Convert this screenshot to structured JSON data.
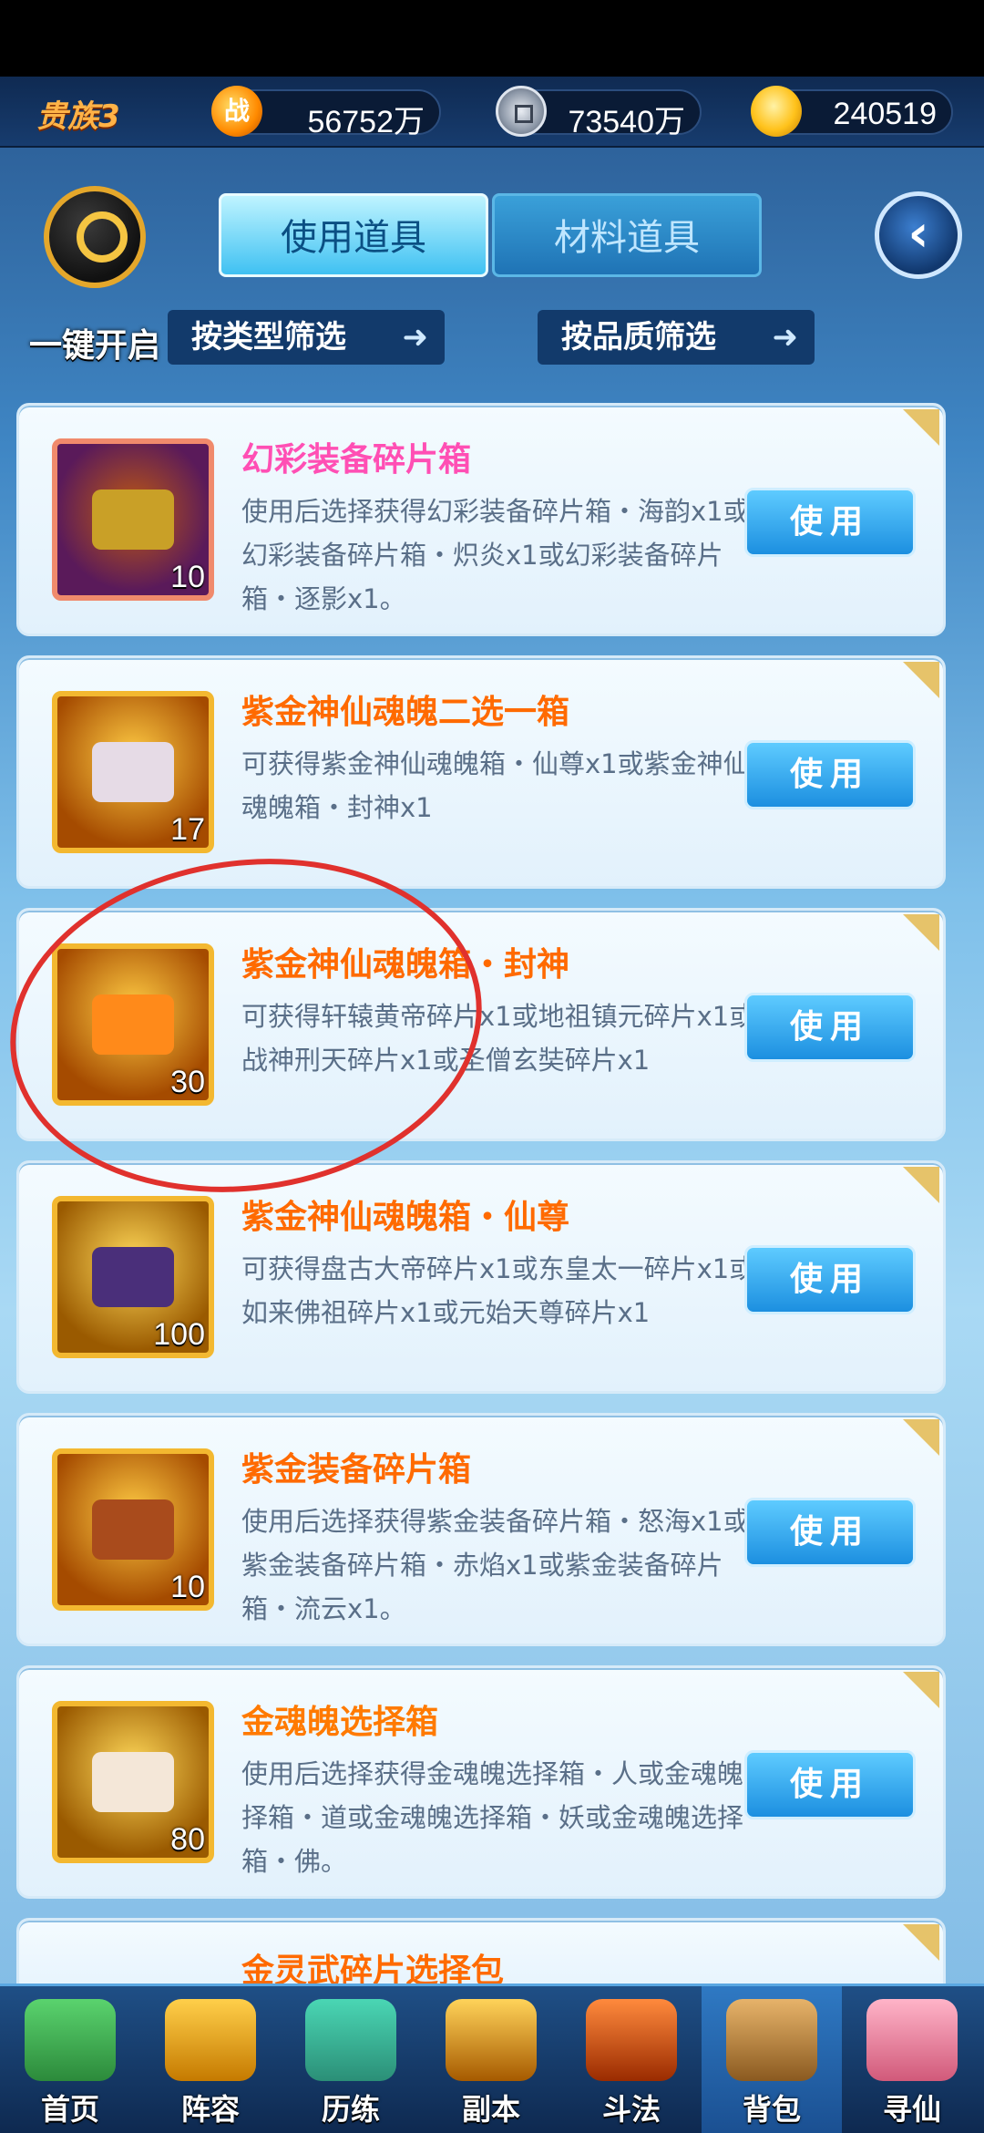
{
  "top": {
    "vip": "贵族3",
    "power_icon": "战",
    "power_value": "56752万",
    "coins_value": "73540万",
    "gold_value": "240519"
  },
  "actions": {
    "one_key": "一键开启"
  },
  "tabs": [
    {
      "label": "使用道具",
      "active": true
    },
    {
      "label": "材料道具",
      "active": false
    }
  ],
  "filters": [
    {
      "label": "按类型筛选"
    },
    {
      "label": "按品质筛选"
    }
  ],
  "items": [
    {
      "name": "幻彩装备碎片箱",
      "desc": "使用后选择获得幻彩装备碎片箱・海韵x1或幻彩装备碎片箱・炽炎x1或幻彩装备碎片箱・逐影x1。",
      "count": "10",
      "button": "使用"
    },
    {
      "name": "紫金神仙魂魄二选一箱",
      "desc": "可获得紫金神仙魂魄箱・仙尊x1或紫金神仙魂魄箱・封神x1",
      "count": "17",
      "button": "使用"
    },
    {
      "name": "紫金神仙魂魄箱・封神",
      "desc": "可获得轩辕黄帝碎片x1或地祖镇元碎片x1或战神刑天碎片x1或圣僧玄奘碎片x1",
      "count": "30",
      "button": "使用"
    },
    {
      "name": "紫金神仙魂魄箱・仙尊",
      "desc": "可获得盘古大帝碎片x1或东皇太一碎片x1或如来佛祖碎片x1或元始天尊碎片x1",
      "count": "100",
      "button": "使用"
    },
    {
      "name": "紫金装备碎片箱",
      "desc": "使用后选择获得紫金装备碎片箱・怒海x1或紫金装备碎片箱・赤焰x1或紫金装备碎片箱・流云x1。",
      "count": "10",
      "button": "使用"
    },
    {
      "name": "金魂魄选择箱",
      "desc": "使用后选择获得金魂魄选择箱・人或金魂魄选择箱・道或金魂魄选择箱・妖或金魂魄选择箱・佛。",
      "count": "80",
      "button": "使用"
    },
    {
      "name": "金灵武碎片选择包",
      "desc": "",
      "count": "",
      "button": ""
    }
  ],
  "nav": [
    {
      "label": "首页"
    },
    {
      "label": "阵容"
    },
    {
      "label": "历练"
    },
    {
      "label": "副本"
    },
    {
      "label": "斗法"
    },
    {
      "label": "背包"
    },
    {
      "label": "寻仙"
    }
  ]
}
